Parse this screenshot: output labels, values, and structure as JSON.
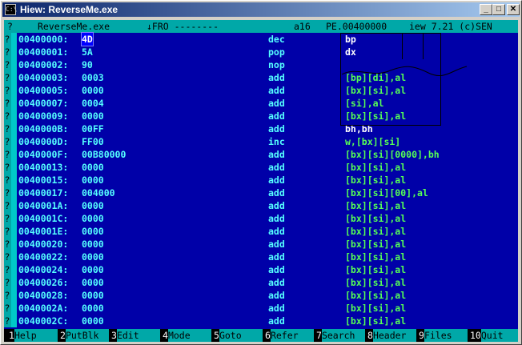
{
  "window": {
    "title": "Hiew: ReverseMe.exe",
    "icon_label": "C:\\",
    "controls": [
      "minimize-icon",
      "maximize-icon",
      "close-icon"
    ]
  },
  "status": {
    "filename": "ReverseMe.exe",
    "mode": "↓FRO --------",
    "bitness": "a16",
    "address": "PE.00400000",
    "version": "iew 7.21 (c)SEN"
  },
  "rows": [
    {
      "q": "?",
      "addr": "00400000:",
      "hex": "4D",
      "mn": "dec",
      "op": "bp",
      "op_white": true,
      "cursor": true
    },
    {
      "q": "?",
      "addr": "00400001:",
      "hex": "5A",
      "mn": "pop",
      "op": "dx",
      "op_white": true
    },
    {
      "q": "?",
      "addr": "00400002:",
      "hex": "90",
      "mn": "nop",
      "op": ""
    },
    {
      "q": "?",
      "addr": "00400003:",
      "hex": "0003",
      "mn": "add",
      "op": "[bp][di],al"
    },
    {
      "q": "?",
      "addr": "00400005:",
      "hex": "0000",
      "mn": "add",
      "op": "[bx][si],al"
    },
    {
      "q": "?",
      "addr": "00400007:",
      "hex": "0004",
      "mn": "add",
      "op": "[si],al"
    },
    {
      "q": "?",
      "addr": "00400009:",
      "hex": "0000",
      "mn": "add",
      "op": "[bx][si],al"
    },
    {
      "q": "?",
      "addr": "0040000B:",
      "hex": "00FF",
      "mn": "add",
      "op": "bh,bh",
      "op_white": true
    },
    {
      "q": "?",
      "addr": "0040000D:",
      "hex": "FF00",
      "mn": "inc",
      "op": "w,[bx][si]"
    },
    {
      "q": "?",
      "addr": "0040000F:",
      "hex": "00B80000",
      "mn": "add",
      "op": "[bx][si][0000],bh"
    },
    {
      "q": "?",
      "addr": "00400013:",
      "hex": "0000",
      "mn": "add",
      "op": "[bx][si],al"
    },
    {
      "q": "?",
      "addr": "00400015:",
      "hex": "0000",
      "mn": "add",
      "op": "[bx][si],al"
    },
    {
      "q": "?",
      "addr": "00400017:",
      "hex": "004000",
      "mn": "add",
      "op": "[bx][si][00],al"
    },
    {
      "q": "?",
      "addr": "0040001A:",
      "hex": "0000",
      "mn": "add",
      "op": "[bx][si],al"
    },
    {
      "q": "?",
      "addr": "0040001C:",
      "hex": "0000",
      "mn": "add",
      "op": "[bx][si],al"
    },
    {
      "q": "?",
      "addr": "0040001E:",
      "hex": "0000",
      "mn": "add",
      "op": "[bx][si],al"
    },
    {
      "q": "?",
      "addr": "00400020:",
      "hex": "0000",
      "mn": "add",
      "op": "[bx][si],al"
    },
    {
      "q": "?",
      "addr": "00400022:",
      "hex": "0000",
      "mn": "add",
      "op": "[bx][si],al"
    },
    {
      "q": "?",
      "addr": "00400024:",
      "hex": "0000",
      "mn": "add",
      "op": "[bx][si],al"
    },
    {
      "q": "?",
      "addr": "00400026:",
      "hex": "0000",
      "mn": "add",
      "op": "[bx][si],al"
    },
    {
      "q": "?",
      "addr": "00400028:",
      "hex": "0000",
      "mn": "add",
      "op": "[bx][si],al"
    },
    {
      "q": "?",
      "addr": "0040002A:",
      "hex": "0000",
      "mn": "add",
      "op": "[bx][si],al"
    },
    {
      "q": "?",
      "addr": "0040002C:",
      "hex": "0000",
      "mn": "add",
      "op": "[bx][si],al"
    }
  ],
  "fkeys": [
    {
      "n": "1",
      "label": "Help"
    },
    {
      "n": "2",
      "label": "PutBlk"
    },
    {
      "n": "3",
      "label": "Edit"
    },
    {
      "n": "4",
      "label": "Mode"
    },
    {
      "n": "5",
      "label": "Goto"
    },
    {
      "n": "6",
      "label": "Refer"
    },
    {
      "n": "7",
      "label": "Search"
    },
    {
      "n": "8",
      "label": "Header"
    },
    {
      "n": "9",
      "label": "Files"
    },
    {
      "n": "10",
      "label": "Quit"
    }
  ],
  "colors": {
    "background": "#0000a8",
    "accent": "#00a8a8",
    "address": "#55ffff",
    "operand": "#55ff55"
  }
}
